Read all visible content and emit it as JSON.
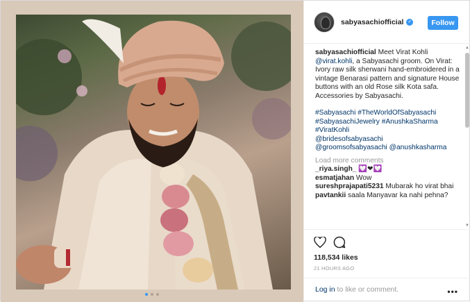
{
  "post": {
    "username": "sabyasachiofficial",
    "follow_label": "Follow",
    "image_alt": "Groom in ivory sherwani and rose safa",
    "carousel": {
      "count": 3,
      "active": 0
    }
  },
  "caption": {
    "user": "sabyasachiofficial",
    "text_1": "Meet Virat Kohli",
    "mention": "@virat.kohli",
    "text_2": ", a Sabyasachi groom.",
    "text_3": "On Virat: Ivory raw silk sherwani hand-embroidered in a vintage Benarasi pattern and signature House buttons with an old Rose silk Kota safa. Accessories by Sabyasachi.",
    "tags": [
      "#Sabyasachi",
      "#TheWorldOfSabyasachi",
      "#SabyasachiJewelry",
      "#AnushkaSharma",
      "#ViratKohli",
      "@bridesofsabyasachi",
      "@groomsofsabyasachi",
      "@anushkasharma"
    ]
  },
  "load_more": "Load more comments",
  "comments": [
    {
      "user": "_riya.singh_",
      "text": "💟❤💟"
    },
    {
      "user": "esmatjahan",
      "text": "Wow"
    },
    {
      "user": "sureshprajapati5231",
      "text": "Mubarak ho virat bhai"
    },
    {
      "user": "pavtankii",
      "text": "saala Manyavar ka nahi pehna?"
    }
  ],
  "stats": {
    "likes": "118,534 likes",
    "time": "21 HOURS AGO"
  },
  "footer": {
    "login": "Log in",
    "rest": " to like or comment."
  },
  "icons": [
    "heart-icon",
    "comment-icon",
    "more-options-icon",
    "verified-badge-icon"
  ],
  "colors": {
    "accent": "#3897f0",
    "link": "#003569",
    "muted": "#999999",
    "frame_bg": "#d9c9b8"
  }
}
